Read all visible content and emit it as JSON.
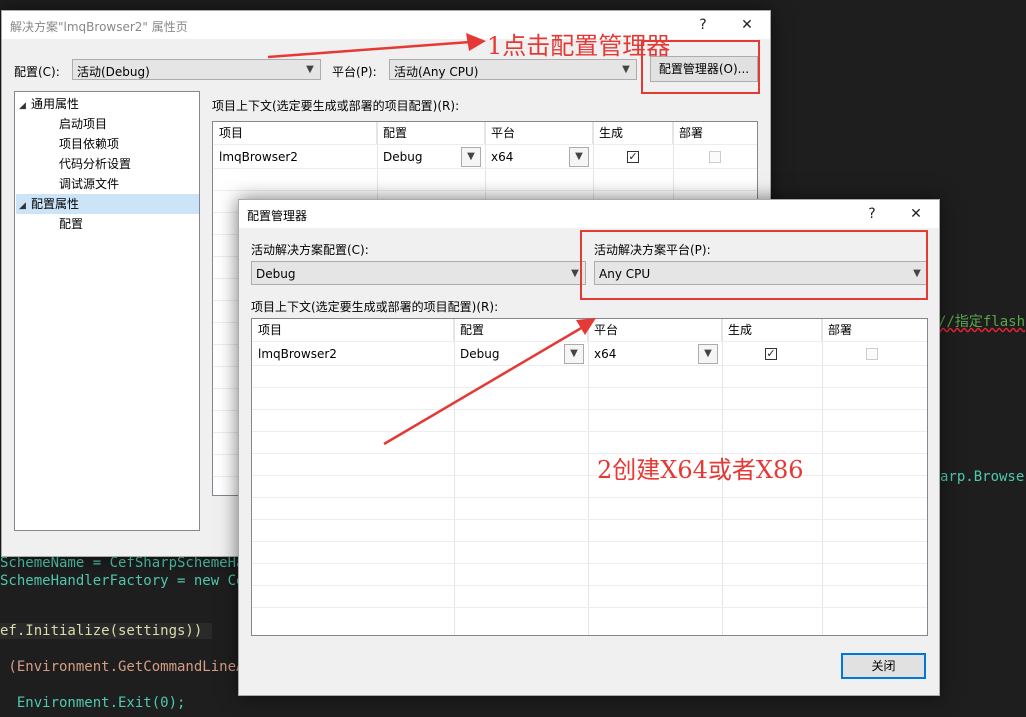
{
  "code": {
    "lines": [
      "SchemeName = CefSharpSchemeHan",
      "SchemeHandlerFactory = new Cef",
      "ef.Initialize(settings))",
      " (Environment.GetCommandLineAr",
      "  Environment.Exit(0);",
      "//指定flash",
      "arp.BrowserS"
    ]
  },
  "prop_dialog": {
    "title": "解决方案\"lmqBrowser2\" 属性页",
    "help_label": "?",
    "close_label": "✕",
    "config_label": "配置(C):",
    "config_value": "活动(Debug)",
    "platform_label": "平台(P):",
    "platform_value": "活动(Any CPU)",
    "config_manager_button": "配置管理器(O)...",
    "tree": [
      {
        "label": "通用属性",
        "level": 0,
        "expanded": true
      },
      {
        "label": "启动项目",
        "level": 1
      },
      {
        "label": "项目依赖项",
        "level": 1
      },
      {
        "label": "代码分析设置",
        "level": 1
      },
      {
        "label": "调试源文件",
        "level": 1
      },
      {
        "label": "配置属性",
        "level": 0,
        "expanded": true,
        "selected": true
      },
      {
        "label": "配置",
        "level": 1
      }
    ],
    "grid_caption": "项目上下文(选定要生成或部署的项目配置)(R):",
    "columns": [
      "项目",
      "配置",
      "平台",
      "生成",
      "部署"
    ],
    "rows": [
      {
        "project": "lmqBrowser2",
        "config": "Debug",
        "platform": "x64",
        "build": true,
        "deploy": false
      }
    ]
  },
  "cm_dialog": {
    "title": "配置管理器",
    "help_label": "?",
    "close_label": "✕",
    "active_config_label": "活动解决方案配置(C):",
    "active_config_value": "Debug",
    "active_platform_label": "活动解决方案平台(P):",
    "active_platform_value": "Any CPU",
    "grid_caption": "项目上下文(选定要生成或部署的项目配置)(R):",
    "columns": [
      "项目",
      "配置",
      "平台",
      "生成",
      "部署"
    ],
    "rows": [
      {
        "project": "lmqBrowser2",
        "config": "Debug",
        "platform": "x64",
        "build": true,
        "deploy": false
      }
    ],
    "close_button": "关闭"
  },
  "annotations": {
    "step1": "1点击配置管理器",
    "step2": "2创建X64或者X86"
  },
  "icons": {
    "dropdown": "chevron-down-icon",
    "tree_expand": "triangle-down-icon",
    "checkbox": "checkbox-icon"
  },
  "colors": {
    "annotation_red": "#e53935",
    "selection_blue": "#cce4f7",
    "default_button_border": "#0078d7"
  }
}
